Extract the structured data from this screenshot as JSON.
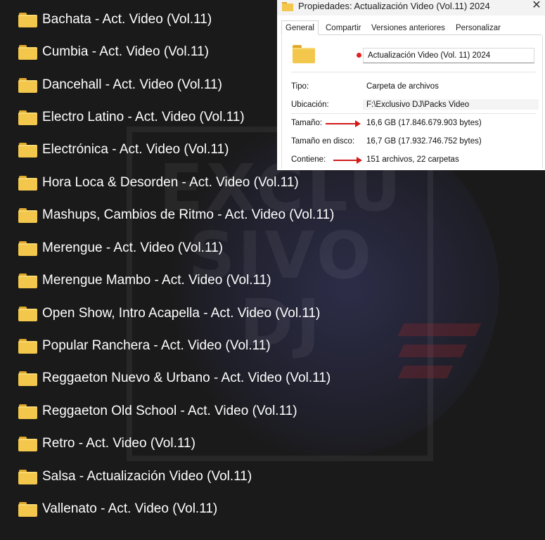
{
  "watermark": {
    "text": "EXCLU\nSIVO\nDJ"
  },
  "folders": [
    "Bachata - Act. Video (Vol.11)",
    "Cumbia - Act. Video (Vol.11)",
    "Dancehall - Act. Video (Vol.11)",
    "Electro Latino - Act. Video (Vol.11)",
    "Electrónica - Act. Video (Vol.11)",
    "Hora Loca & Desorden - Act. Video (Vol.11)",
    "Mashups, Cambios de Ritmo - Act. Video (Vol.11)",
    "Merengue - Act. Video (Vol.11)",
    "Merengue Mambo - Act. Video (Vol.11)",
    "Open Show, Intro Acapella - Act. Video (Vol.11)",
    "Popular Ranchera - Act. Video (Vol.11)",
    "Reggaeton Nuevo & Urbano - Act. Video (Vol.11)",
    "Reggaeton Old School - Act. Video (Vol.11)",
    "Retro - Act. Video (Vol.11)",
    "Salsa - Actualización Video (Vol.11)",
    "Vallenato - Act. Video (Vol.11)"
  ],
  "dialog": {
    "title": "Propiedades: Actualización Video (Vol.11) 2024",
    "close": "✕",
    "tabs": [
      "General",
      "Compartir",
      "Versiones anteriores",
      "Personalizar"
    ],
    "active_tab": "General",
    "name": "Actualización Video (Vol. 11) 2024",
    "props": {
      "tipo_label": "Tipo:",
      "tipo_value": "Carpeta de archivos",
      "ubicacion_label": "Ubicación:",
      "ubicacion_value": "F:\\Exclusivo DJ\\Packs Video",
      "tamano_label": "Tamaño:",
      "tamano_value": "16,6 GB (17.846.679.903 bytes)",
      "disco_label": "Tamaño en disco:",
      "disco_value": "16,7 GB (17.932.746.752 bytes)",
      "contiene_label": "Contiene:",
      "contiene_value": "151 archivos, 22 carpetas"
    }
  },
  "colors": {
    "folder": "#f3c74b",
    "arrow": "#d21a1a",
    "background": "#1a1a1a"
  }
}
